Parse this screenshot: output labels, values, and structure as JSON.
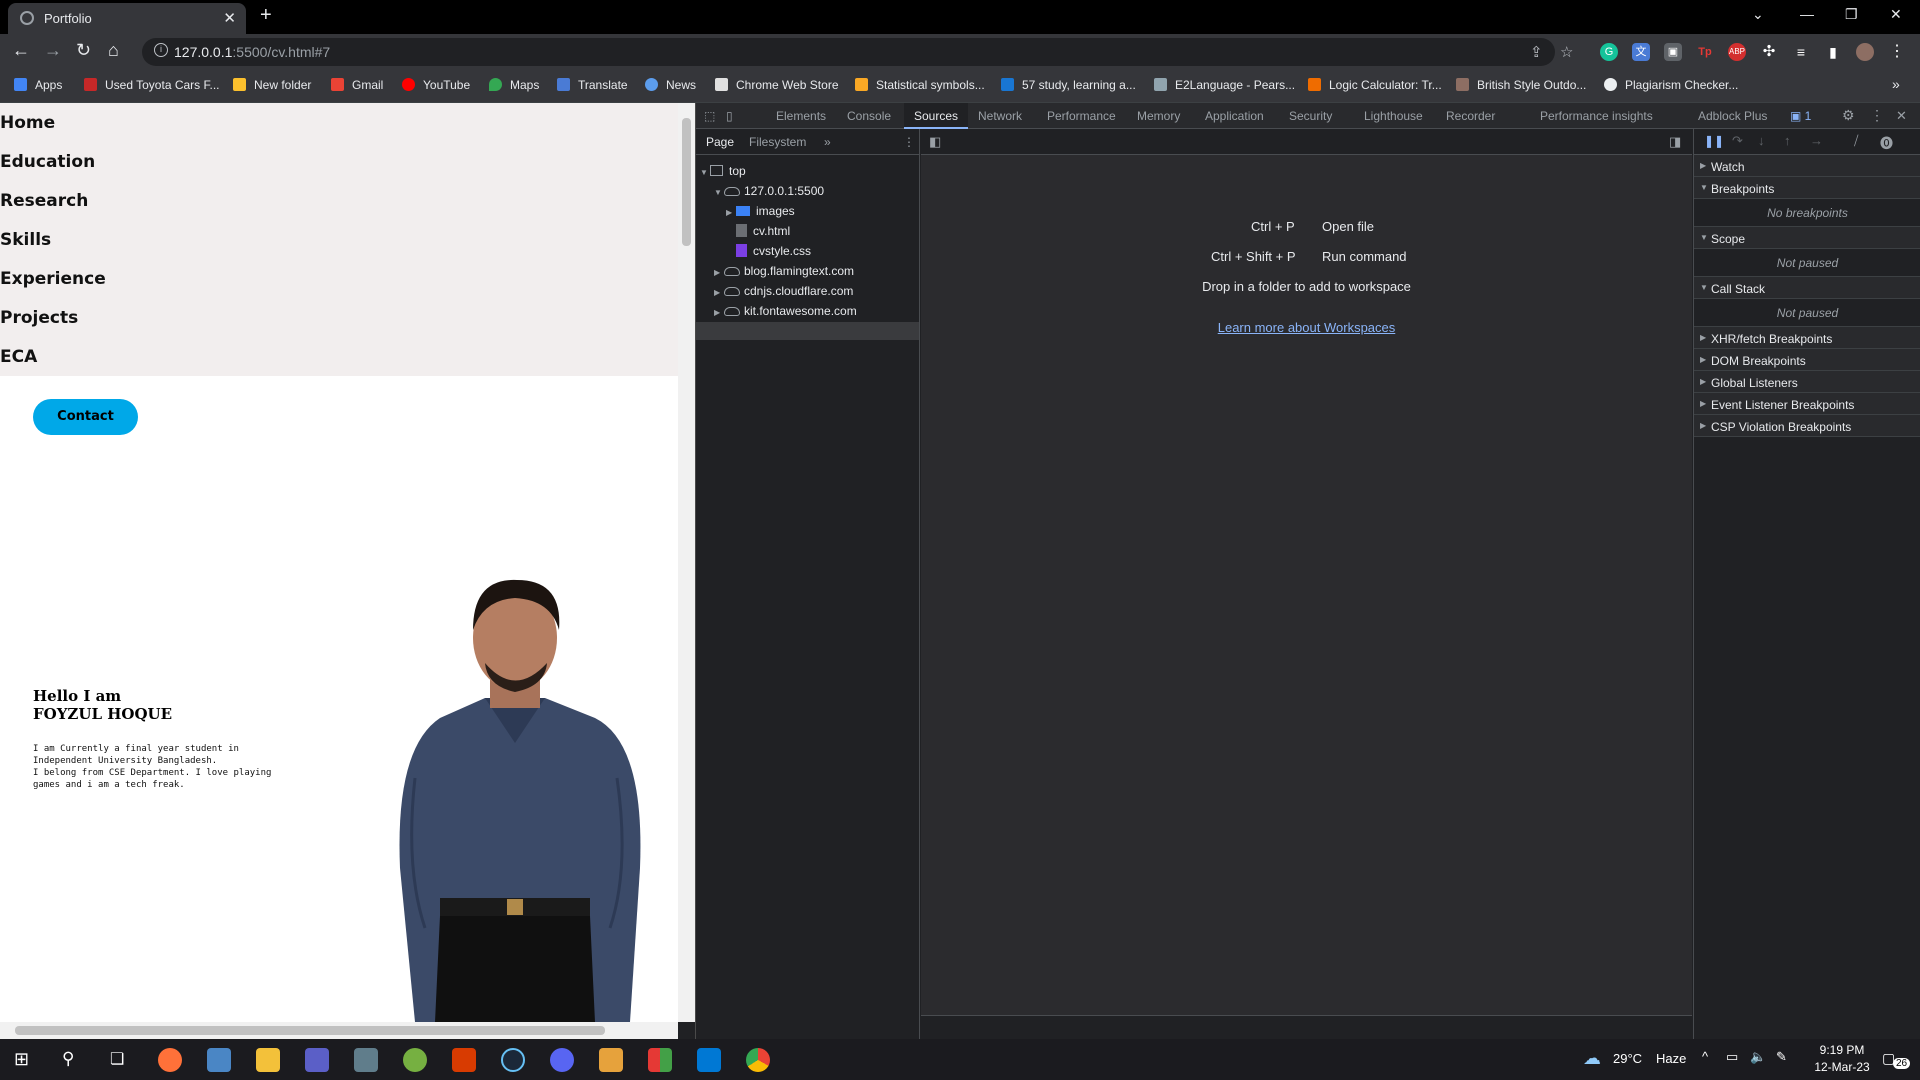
{
  "browser": {
    "tab_title": "Portfolio",
    "url_host": "127.0.0.1",
    "url_rest": ":5500/cv.html#7",
    "bookmarks": [
      "Apps",
      "Used Toyota Cars F...",
      "New folder",
      "Gmail",
      "YouTube",
      "Maps",
      "Translate",
      "News",
      "Chrome Web Store",
      "Statistical symbols...",
      "57 study, learning a...",
      "E2Language - Pears...",
      "Logic Calculator: Tr...",
      "British Style Outdo...",
      "Plagiarism Checker..."
    ]
  },
  "site": {
    "nav": [
      "Home",
      "Education",
      "Research",
      "Skills",
      "Experience",
      "Projects",
      "ECA"
    ],
    "contact_label": "Contact",
    "hello_line1": "Hello I am",
    "hello_line2": "FOYZUL HOQUE",
    "about": [
      "I am Currently a final year student in",
      "Independent University Bangladesh.",
      "I belong from CSE Department. I love playing",
      "games and i am a tech freak."
    ]
  },
  "devtools": {
    "tabs": [
      "Elements",
      "Console",
      "Sources",
      "Network",
      "Performance",
      "Memory",
      "Application",
      "Security",
      "Lighthouse",
      "Recorder",
      "Performance insights",
      "Adblock Plus"
    ],
    "active_tab": "Sources",
    "issues_count": "1",
    "nav_tabs": [
      "Page",
      "Filesystem"
    ],
    "tree": {
      "top": "top",
      "host": "127.0.0.1:5500",
      "folder": "images",
      "file1": "cv.html",
      "file2": "cvstyle.css",
      "d1": "blog.flamingtext.com",
      "d2": "cdnjs.cloudflare.com",
      "d3": "kit.fontawesome.com"
    },
    "shortcuts": [
      {
        "keys": "Ctrl + P",
        "action": "Open file"
      },
      {
        "keys": "Ctrl + Shift + P",
        "action": "Run command"
      }
    ],
    "drop_text": "Drop in a folder to add to workspace",
    "learn_link": "Learn more about Workspaces",
    "panes": {
      "watch": "Watch",
      "breakpoints": "Breakpoints",
      "no_breakpoints": "No breakpoints",
      "scope": "Scope",
      "not_paused": "Not paused",
      "callstack": "Call Stack",
      "not_paused2": "Not paused",
      "xhr": "XHR/fetch Breakpoints",
      "dom": "DOM Breakpoints",
      "global": "Global Listeners",
      "event": "Event Listener Breakpoints",
      "csp": "CSP Violation Breakpoints"
    }
  },
  "taskbar": {
    "temp": "29°C",
    "weather": "Haze",
    "time": "9:19 PM",
    "date": "12-Mar-23",
    "notif_count": "26"
  },
  "colors": {
    "accent": "#00a8e8",
    "devtools_link": "#8ab4f8",
    "chrome_dark": "#35363a"
  }
}
